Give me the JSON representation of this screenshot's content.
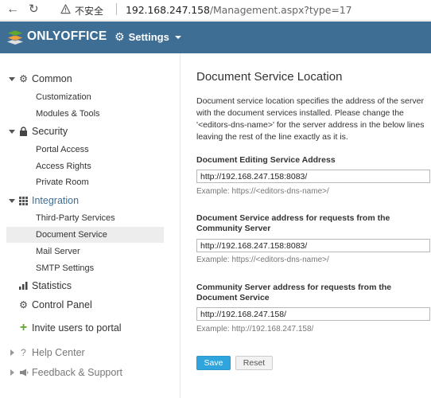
{
  "browser": {
    "insecure_label": "不安全",
    "url_host": "192.168.247.158",
    "url_path": "/Management.aspx?type=17"
  },
  "header": {
    "brand": "ONLYOFFICE",
    "settings_label": "Settings"
  },
  "sidebar": {
    "common": {
      "label": "Common",
      "items": [
        "Customization",
        "Modules & Tools"
      ]
    },
    "security": {
      "label": "Security",
      "items": [
        "Portal Access",
        "Access Rights",
        "Private Room"
      ]
    },
    "integration": {
      "label": "Integration",
      "items": [
        "Third-Party Services",
        "Document Service",
        "Mail Server",
        "SMTP Settings"
      ]
    },
    "statistics": "Statistics",
    "control_panel": "Control Panel",
    "invite": "Invite users to portal",
    "help": "Help Center",
    "feedback": "Feedback & Support"
  },
  "main": {
    "title": "Document Service Location",
    "description": "Document service location specifies the address of the server with the document services installed. Please change the '<editors-dns-name>' for the server address in the below lines leaving the rest of the line exactly as it is.",
    "fields": [
      {
        "label": "Document Editing Service Address",
        "value": "http://192.168.247.158:8083/",
        "hint": "Example: https://<editors-dns-name>/"
      },
      {
        "label": "Document Service address for requests from the Community Server",
        "value": "http://192.168.247.158:8083/",
        "hint": "Example: https://<editors-dns-name>/"
      },
      {
        "label": "Community Server address for requests from the Document Service",
        "value": "http://192.168.247.158/",
        "hint": "Example: http://192.168.247.158/"
      }
    ],
    "save_label": "Save",
    "reset_label": "Reset"
  },
  "colors": {
    "header_bg": "#3f6e94",
    "accent": "#3f6e94",
    "save_button": "#2fa4dd",
    "invite_plus": "#5fa72f"
  }
}
